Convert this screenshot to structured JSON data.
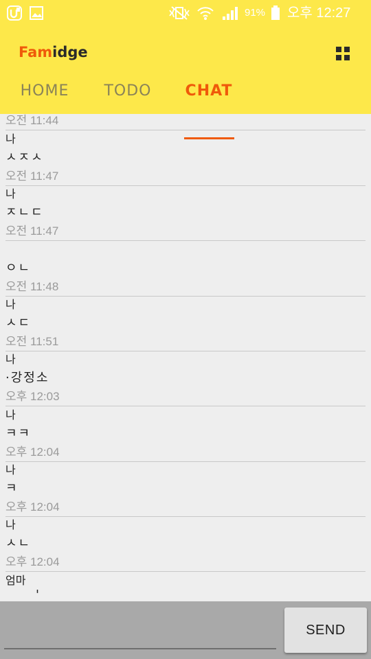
{
  "status_bar": {
    "battery_percent": "91%",
    "clock": "오후 12:27",
    "icons": [
      "u-plus-icon",
      "gallery-icon",
      "vibrate-mute-icon",
      "wifi-icon",
      "signal-icon",
      "battery-icon"
    ]
  },
  "app": {
    "logo_part1": "Fam",
    "logo_part2": "idge",
    "menu_icon": "grid-icon",
    "accent_color": "#ef5a0a",
    "header_color": "#fde84a"
  },
  "tabs": [
    {
      "label": "HOME",
      "active": false
    },
    {
      "label": "TODO",
      "active": false
    },
    {
      "label": "CHAT",
      "active": true
    }
  ],
  "messages": [
    {
      "sender": "",
      "body": "",
      "time": "오전 11:44"
    },
    {
      "sender": "나",
      "body": "ㅅㅈㅅ",
      "time": "오전 11:47"
    },
    {
      "sender": "나",
      "body": "ㅈㄴㄷ",
      "time": "오전 11:47"
    },
    {
      "sender": "",
      "body": "ㅇㄴ",
      "time": "오전 11:48"
    },
    {
      "sender": "나",
      "body": "ㅅㄷ",
      "time": "오전 11:51"
    },
    {
      "sender": "나",
      "body": "·강정소",
      "time": "오후 12:03"
    },
    {
      "sender": "나",
      "body": "ㅋㅋ",
      "time": "오후 12:04"
    },
    {
      "sender": "나",
      "body": "ㅋ",
      "time": "오후 12:04"
    },
    {
      "sender": "나",
      "body": "ㅅㄴ",
      "time": "오후 12:04"
    },
    {
      "sender": "엄마",
      "body": "'",
      "time": ""
    }
  ],
  "composer": {
    "input_value": "",
    "send_label": "SEND"
  }
}
